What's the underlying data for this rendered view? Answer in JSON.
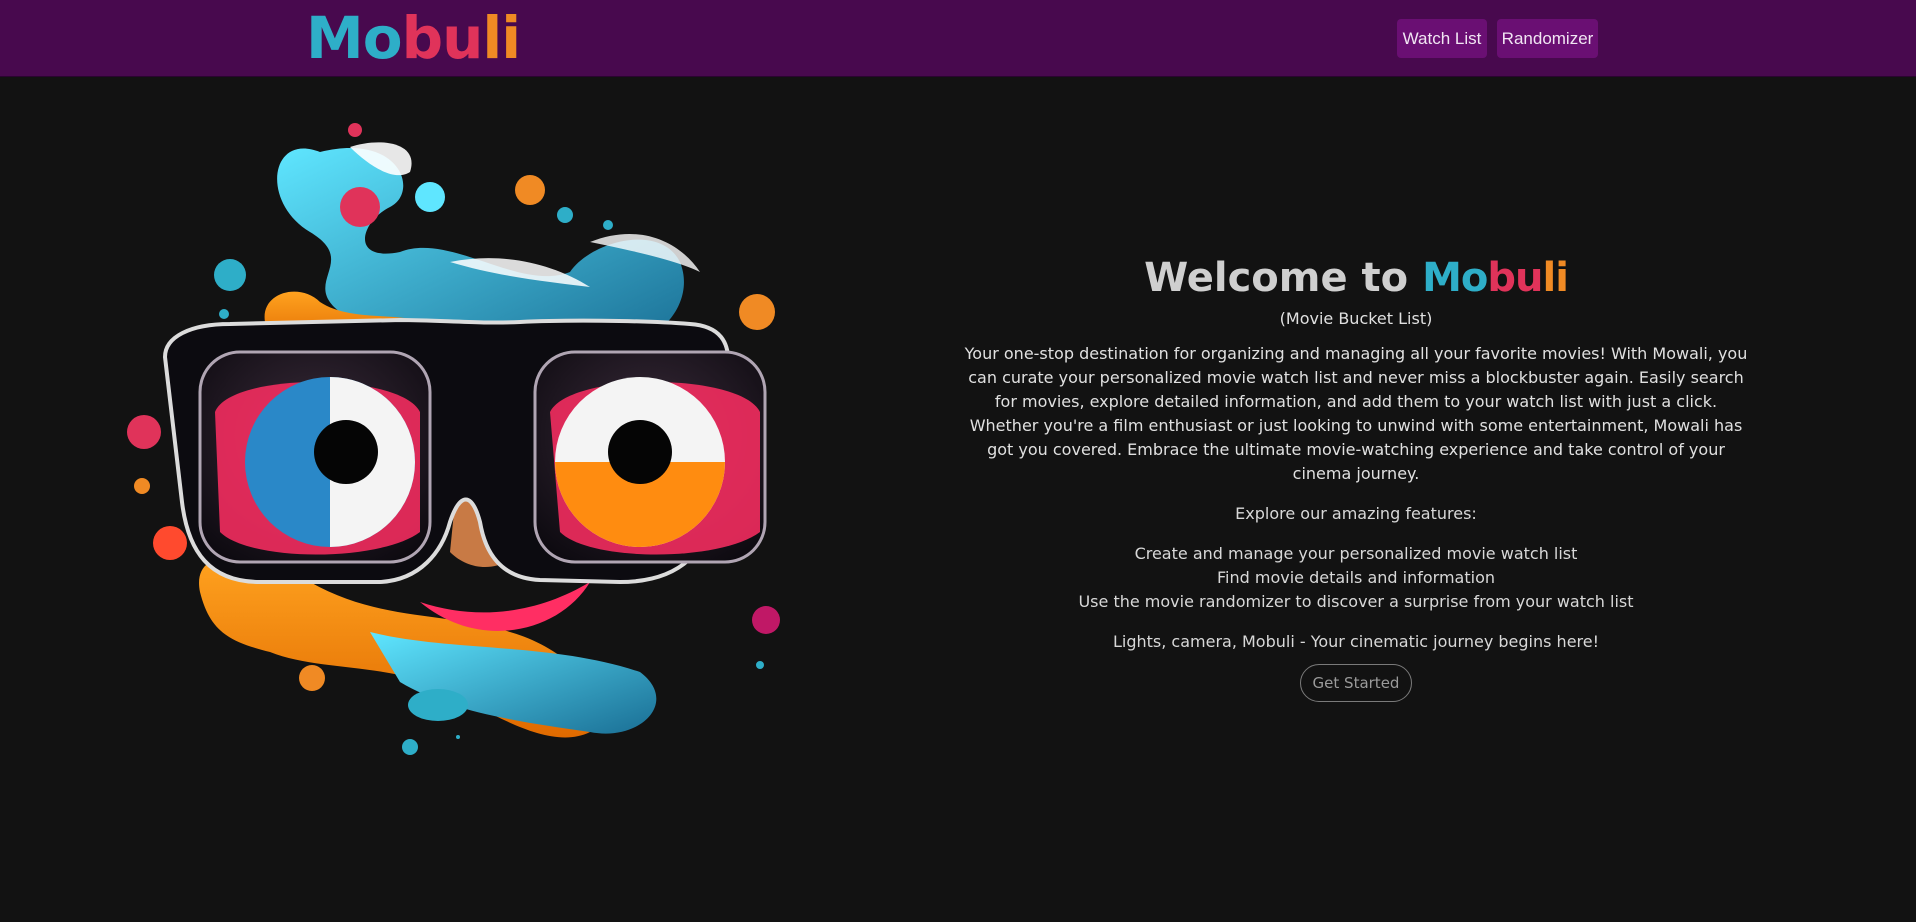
{
  "header": {
    "brand_letters": [
      "M",
      "o",
      "b",
      "u",
      "l",
      "i"
    ],
    "brand_colors": [
      "#2eaec8",
      "#2eaec8",
      "#e0335a",
      "#e0335a",
      "#f08a24",
      "#f08a24"
    ],
    "nav": {
      "watch_list": "Watch List",
      "randomizer": "Randomizer"
    },
    "nav_bg": "#48094e",
    "button_bg": "#6a0f73"
  },
  "hero": {
    "welcome": "Welcome to",
    "logo_letters": [
      "M",
      "o",
      "b",
      "u",
      "l",
      "i"
    ],
    "subtitle": "(Movie Bucket List)",
    "description": "Your one-stop destination for organizing and managing all your favorite movies! With Mowali, you can curate your personalized movie watch list and never miss a blockbuster again. Easily search for movies, explore detailed information, and add them to your watch list with just a click. Whether you're a film enthusiast or just looking to unwind with some entertainment, Mowali has got you covered. Embrace the ultimate movie-watching experience and take control of your cinema journey.",
    "features_title": "Explore our amazing features:",
    "features": [
      "Create and manage your personalized movie watch list",
      "Find movie details and information",
      "Use the movie randomizer to discover a surprise from your watch list"
    ],
    "tagline": "Lights, camera, Mobuli - Your cinematic journey begins here!",
    "cta": "Get Started"
  },
  "illustration": {
    "icon": "mascot-glasses-illustration"
  },
  "colors": {
    "background": "#121212",
    "text": "#e0e0e0"
  }
}
